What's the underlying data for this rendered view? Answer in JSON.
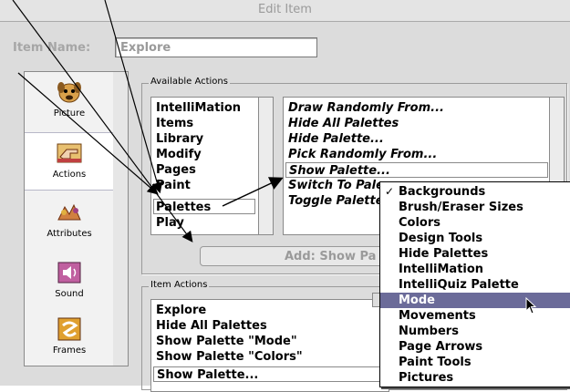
{
  "window": {
    "title": "Edit Item"
  },
  "item_name": {
    "label": "Item Name:",
    "value": "Explore"
  },
  "sidebar": {
    "items": [
      {
        "label": "Picture",
        "icon": "dog-face-icon"
      },
      {
        "label": "Actions",
        "icon": "pointing-hand-icon",
        "selected": true
      },
      {
        "label": "Attributes",
        "icon": "animals-icon"
      },
      {
        "label": "Sound",
        "icon": "speaker-icon"
      },
      {
        "label": "Frames",
        "icon": "film-frames-icon"
      }
    ]
  },
  "available_actions": {
    "title": "Available Actions",
    "categories": [
      "IntelliMation",
      "Items",
      "Library",
      "Modify",
      "Pages",
      "Paint",
      "Palettes",
      "Play"
    ],
    "selected_category": "Palettes",
    "actions": [
      "Draw Randomly From...",
      "Hide All Palettes",
      "Hide Palette...",
      "Pick Randomly From...",
      "Show Palette...",
      "Switch To Pale",
      "Toggle Palette"
    ],
    "selected_action": "Show Palette...",
    "add_button": "Add:  Show Pa"
  },
  "item_actions": {
    "title": "Item Actions",
    "items": [
      "Explore",
      "Hide All Palettes",
      "Show Palette \"Mode\"",
      "Show Palette \"Colors\"",
      "Show Palette..."
    ]
  },
  "popup_menu": {
    "items": [
      "Backgrounds",
      "Brush/Eraser Sizes",
      "Colors",
      "Design Tools",
      "Hide Palettes",
      "IntelliMation",
      "IntelliQuiz Palette",
      "Mode",
      "Movements",
      "Numbers",
      "Page Arrows",
      "Paint Tools",
      "Pictures"
    ],
    "checked": "Backgrounds",
    "highlighted": "Mode",
    "check_glyph": "✓"
  },
  "colors": {
    "highlight": "#6b6b99",
    "window_bg": "#dcdcdc"
  }
}
